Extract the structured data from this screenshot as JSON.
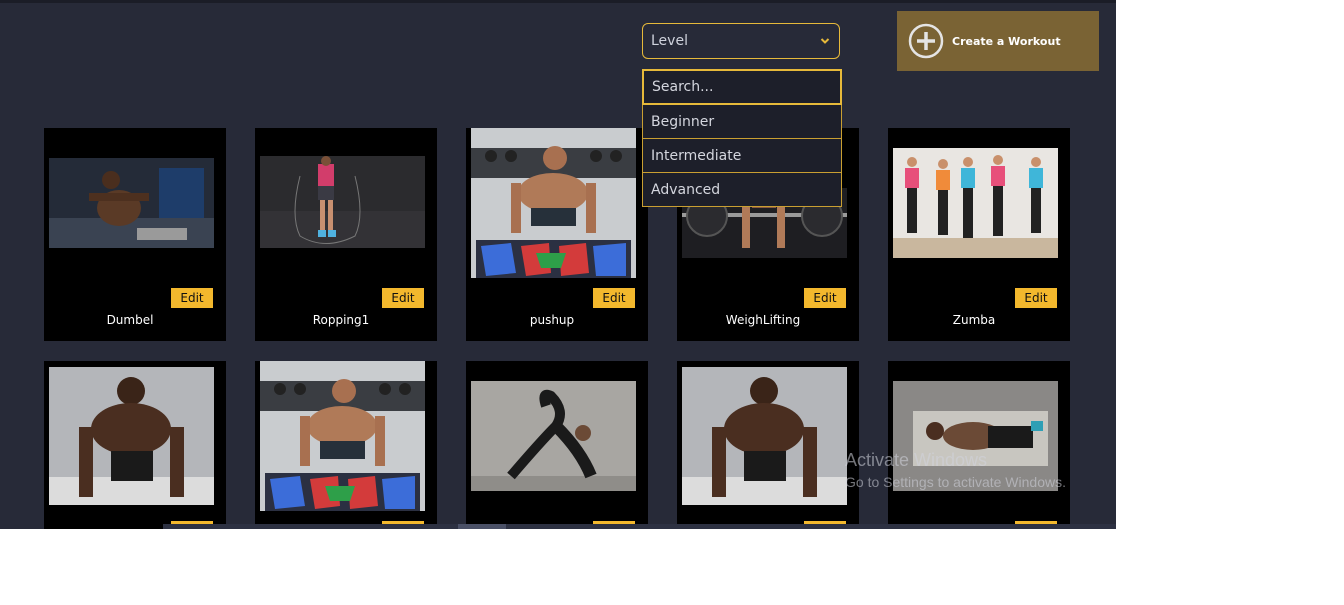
{
  "level_select": {
    "label": "Level",
    "search_placeholder": "Search...",
    "options": [
      "Beginner",
      "Intermediate",
      "Advanced"
    ]
  },
  "create_button": {
    "label": "Create a Workout"
  },
  "edit_label": "Edit",
  "workouts": [
    {
      "name": "Dumbel"
    },
    {
      "name": "Ropping1"
    },
    {
      "name": "pushup"
    },
    {
      "name": "WeighLifting"
    },
    {
      "name": "Zumba"
    },
    {
      "name": ""
    },
    {
      "name": ""
    },
    {
      "name": ""
    },
    {
      "name": ""
    },
    {
      "name": ""
    }
  ],
  "watermark": {
    "line1": "Activate Windows",
    "line2": "Go to Settings to activate Windows."
  },
  "colors": {
    "background": "#272a38",
    "accent": "#e6b93a",
    "create_button": "#7a6334",
    "edit_button": "#f3b82d"
  }
}
